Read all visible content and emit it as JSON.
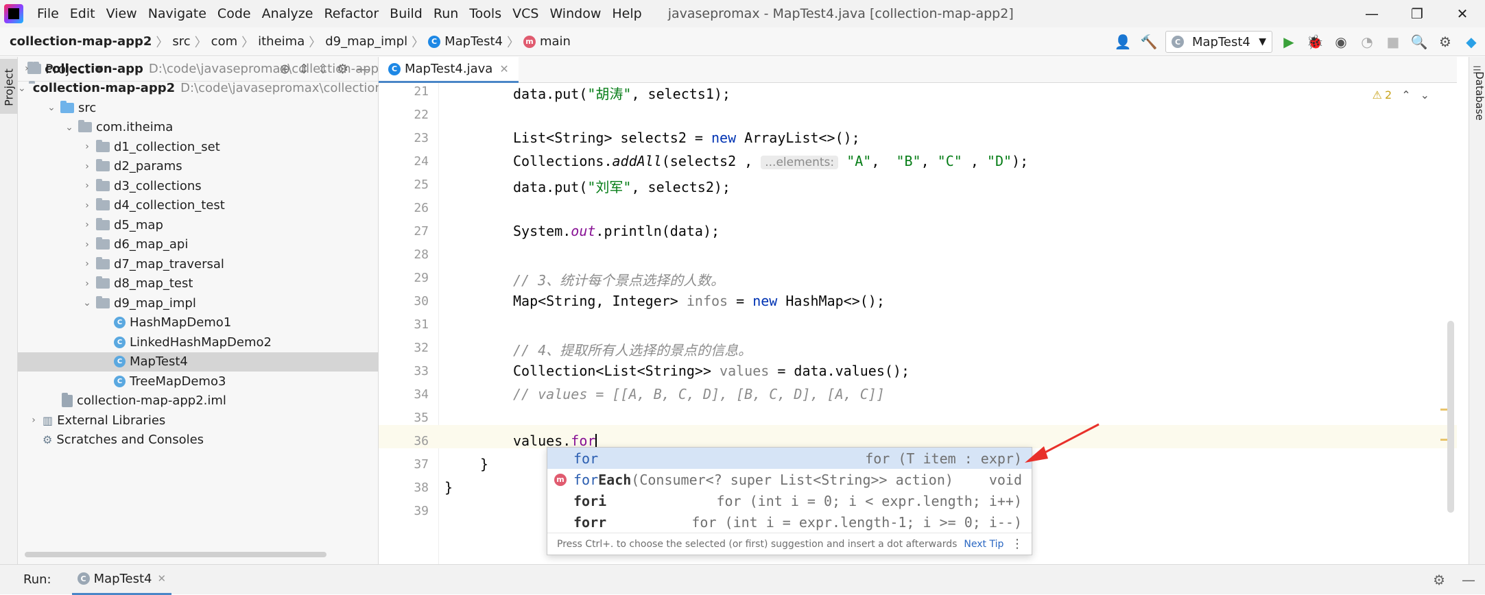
{
  "menu": [
    "File",
    "Edit",
    "View",
    "Navigate",
    "Code",
    "Analyze",
    "Refactor",
    "Build",
    "Run",
    "Tools",
    "VCS",
    "Window",
    "Help"
  ],
  "window_title": "javasepromax - MapTest4.java [collection-map-app2]",
  "window_controls": {
    "minimize": "—",
    "restore": "❐",
    "close": "✕"
  },
  "breadcrumb": [
    "collection-map-app2",
    "src",
    "com",
    "itheima",
    "d9_map_impl",
    "MapTest4",
    "main"
  ],
  "run_config": "MapTest4",
  "project_panel": {
    "title": "Project",
    "tree": [
      {
        "label": "collection-app",
        "path": "D:\\code\\javasepromax\\collection-app",
        "arrow": "›",
        "kind": "module",
        "bold": true
      },
      {
        "label": "collection-map-app2",
        "path": "D:\\code\\javasepromax\\collection-",
        "arrow": "⌄",
        "kind": "module",
        "bold": true
      },
      {
        "label": "src",
        "arrow": "⌄",
        "kind": "src"
      },
      {
        "label": "com.itheima",
        "arrow": "⌄",
        "kind": "package"
      },
      {
        "label": "d1_collection_set",
        "arrow": "›",
        "kind": "package"
      },
      {
        "label": "d2_params",
        "arrow": "›",
        "kind": "package"
      },
      {
        "label": "d3_collections",
        "arrow": "›",
        "kind": "package"
      },
      {
        "label": "d4_collection_test",
        "arrow": "›",
        "kind": "package"
      },
      {
        "label": "d5_map",
        "arrow": "›",
        "kind": "package"
      },
      {
        "label": "d6_map_api",
        "arrow": "›",
        "kind": "package"
      },
      {
        "label": "d7_map_traversal",
        "arrow": "›",
        "kind": "package"
      },
      {
        "label": "d8_map_test",
        "arrow": "›",
        "kind": "package"
      },
      {
        "label": "d9_map_impl",
        "arrow": "⌄",
        "kind": "package"
      },
      {
        "label": "HashMapDemo1",
        "kind": "class"
      },
      {
        "label": "LinkedHashMapDemo2",
        "kind": "class"
      },
      {
        "label": "MapTest4",
        "kind": "class",
        "selected": true
      },
      {
        "label": "TreeMapDemo3",
        "kind": "class"
      },
      {
        "label": "collection-map-app2.iml",
        "kind": "iml"
      },
      {
        "label": "External Libraries",
        "arrow": "›",
        "kind": "lib"
      },
      {
        "label": "Scratches and Consoles",
        "kind": "scratch"
      }
    ]
  },
  "editor": {
    "tab": "MapTest4.java",
    "line_numbers": [
      "21",
      "22",
      "23",
      "24",
      "25",
      "26",
      "27",
      "28",
      "29",
      "30",
      "31",
      "32",
      "33",
      "34",
      "35",
      "36",
      "37",
      "38",
      "39"
    ],
    "code": {
      "l21a": "data.put(",
      "l21s": "\"胡涛\"",
      "l21b": ", selects1);",
      "l23a": "List<String> selects2 = ",
      "l23k": "new",
      "l23b": " ArrayList<>();",
      "l24a": "Collections.",
      "l24m": "addAll",
      "l24b": "(selects2 , ",
      "l24hint": "...elements:",
      "l24s1": "\"A\"",
      "l24c1": ",  ",
      "l24s2": "\"B\"",
      "l24c2": ", ",
      "l24s3": "\"C\"",
      "l24c3": " , ",
      "l24s4": "\"D\"",
      "l24end": ");",
      "l25a": "data.put(",
      "l25s": "\"刘军\"",
      "l25b": ", selects2);",
      "l27a": "System.",
      "l27f": "out",
      "l27b": ".println(data);",
      "l29": "// 3、统计每个景点选择的人数。",
      "l30a": "Map<String, Integer> ",
      "l30v": "infos",
      "l30b": " = ",
      "l30k": "new",
      "l30c": " HashMap<>();",
      "l32": "// 4、提取所有人选择的景点的信息。",
      "l33a": "Collection<List<String>> ",
      "l33v": "values",
      "l33b": " = data.values();",
      "l34": "// values = [[A, B, C, D], [B, C, D], [A, C]]",
      "l36a": "values.",
      "l36b": "for",
      "l37": "}",
      "l38": "}"
    },
    "warnings": {
      "icon": "⚠",
      "count": "2",
      "up": "⌃",
      "down": "⌄"
    }
  },
  "completion": {
    "items": [
      {
        "match": "for",
        "tail": "",
        "desc": "for (T item : expr)",
        "selected": true
      },
      {
        "match": "for",
        "tail": "Each",
        "sig": "(Consumer<? super List<String>> action)",
        "desc": "void",
        "badge": "m"
      },
      {
        "match": "for",
        "tail": "i",
        "desc": "for (int i = 0; i < expr.length; i++)"
      },
      {
        "match": "for",
        "tail": "r",
        "desc": "for (int i = expr.length-1; i >= 0; i--)"
      }
    ],
    "footer": "Press Ctrl+. to choose the selected (or first) suggestion and insert a dot afterwards",
    "next_tip": "Next Tip"
  },
  "right_strip": "Database",
  "run_bar": {
    "label": "Run:",
    "tab": "MapTest4"
  },
  "colors": {
    "accent": "#4a86c7",
    "keyword": "#0033b3",
    "string": "#067d17",
    "comment": "#8c8c8c",
    "annotation_arrow": "#e8302a"
  }
}
